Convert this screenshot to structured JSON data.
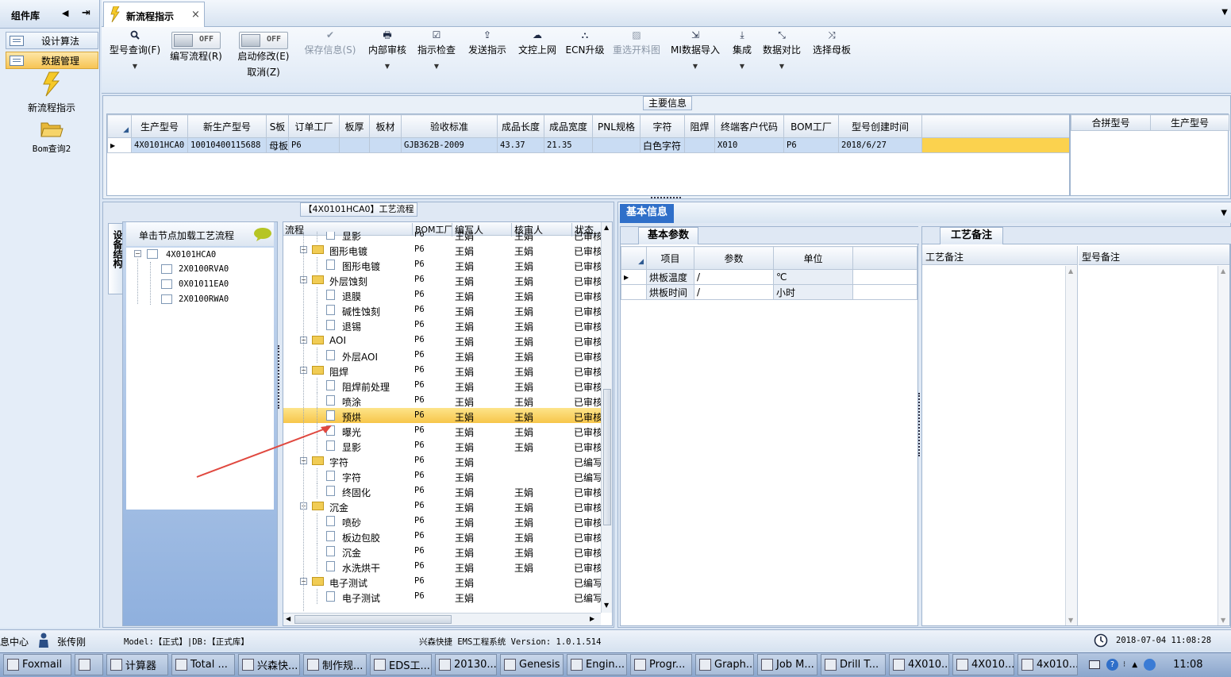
{
  "sidebar": {
    "title": "组件库",
    "items": [
      {
        "label": "设计算法"
      },
      {
        "label": "数据管理"
      }
    ],
    "launch": [
      {
        "label": "新流程指示"
      },
      {
        "label": "Bom查询2"
      }
    ]
  },
  "tabs": [
    {
      "label": "新流程指示",
      "close": "×"
    }
  ],
  "toolbar": {
    "query": {
      "label": "型号查询(F)"
    },
    "edit_flow": {
      "label": "编写流程(R)",
      "state": "OFF"
    },
    "start_edit": {
      "label": "启动修改(E)",
      "state": "OFF",
      "cancel": "取消(Z)"
    },
    "save": {
      "label": "保存信息(S)"
    },
    "review": {
      "label": "内部审核"
    },
    "check": {
      "label": "指示检查"
    },
    "send": {
      "label": "发送指示"
    },
    "doc_online": {
      "label": "文控上网"
    },
    "ecn": {
      "label": "ECN升级"
    },
    "reselect": {
      "label": "重选开料图"
    },
    "mi_import": {
      "label": "MI数据导入"
    },
    "integrate": {
      "label": "集成"
    },
    "compare": {
      "label": "数据对比"
    },
    "mother": {
      "label": "选择母板"
    }
  },
  "main_info": {
    "title": "主要信息",
    "columns": [
      "生产型号",
      "新生产型号",
      "S板",
      "订单工厂",
      "板厚",
      "板材",
      "验收标准",
      "成品长度",
      "成品宽度",
      "PNL规格",
      "字符",
      "阻焊",
      "终端客户代码",
      "BOM工厂",
      "型号创建时间"
    ],
    "row": [
      "4X0101HCA0",
      "10010400115688",
      "母板",
      "P6",
      "",
      "",
      "GJB362B-2009",
      "43.37",
      "21.35",
      "",
      "白色字符",
      "",
      "X010",
      "P6",
      "2018/6/27"
    ],
    "side_columns": [
      "合拼型号",
      "生产型号"
    ]
  },
  "flow": {
    "title": "【4X0101HCA0】工艺流程",
    "panel_tab": "设备结构",
    "load_hint": "单击节点加载工艺流程",
    "tree": [
      {
        "label": "4X0101HCA0"
      },
      {
        "label": "2X0100RVA0"
      },
      {
        "label": "0X01011EA0"
      },
      {
        "label": "2X0100RWA0"
      }
    ],
    "columns": [
      "流程",
      "BOM工厂",
      "编写人",
      "核审人",
      "状态"
    ],
    "rows": [
      {
        "name": "显影",
        "lvl": 2,
        "bom": "P6",
        "writer": "王娟",
        "rev": "王娟",
        "status": "已审核"
      },
      {
        "name": "图形电镀",
        "lvl": 1,
        "bom": "P6",
        "writer": "王娟",
        "rev": "王娟",
        "status": "已审核"
      },
      {
        "name": "图形电镀",
        "lvl": 2,
        "bom": "P6",
        "writer": "王娟",
        "rev": "王娟",
        "status": "已审核"
      },
      {
        "name": "外层蚀刻",
        "lvl": 1,
        "bom": "P6",
        "writer": "王娟",
        "rev": "王娟",
        "status": "已审核"
      },
      {
        "name": "退膜",
        "lvl": 2,
        "bom": "P6",
        "writer": "王娟",
        "rev": "王娟",
        "status": "已审核"
      },
      {
        "name": "碱性蚀刻",
        "lvl": 2,
        "bom": "P6",
        "writer": "王娟",
        "rev": "王娟",
        "status": "已审核"
      },
      {
        "name": "退锡",
        "lvl": 2,
        "bom": "P6",
        "writer": "王娟",
        "rev": "王娟",
        "status": "已审核"
      },
      {
        "name": "AOI",
        "lvl": 1,
        "bom": "P6",
        "writer": "王娟",
        "rev": "王娟",
        "status": "已审核"
      },
      {
        "name": "外层AOI",
        "lvl": 2,
        "bom": "P6",
        "writer": "王娟",
        "rev": "王娟",
        "status": "已审核"
      },
      {
        "name": "阻焊",
        "lvl": 1,
        "bom": "P6",
        "writer": "王娟",
        "rev": "王娟",
        "status": "已审核"
      },
      {
        "name": "阻焊前处理",
        "lvl": 2,
        "bom": "P6",
        "writer": "王娟",
        "rev": "王娟",
        "status": "已审核"
      },
      {
        "name": "喷涂",
        "lvl": 2,
        "bom": "P6",
        "writer": "王娟",
        "rev": "王娟",
        "status": "已审核"
      },
      {
        "name": "预烘",
        "lvl": 2,
        "bom": "P6",
        "writer": "王娟",
        "rev": "王娟",
        "status": "已审核"
      },
      {
        "name": "曝光",
        "lvl": 2,
        "bom": "P6",
        "writer": "王娟",
        "rev": "王娟",
        "status": "已审核"
      },
      {
        "name": "显影",
        "lvl": 2,
        "bom": "P6",
        "writer": "王娟",
        "rev": "王娟",
        "status": "已审核"
      },
      {
        "name": "字符",
        "lvl": 1,
        "bom": "P6",
        "writer": "王娟",
        "rev": "",
        "status": "已编写"
      },
      {
        "name": "字符",
        "lvl": 2,
        "bom": "P6",
        "writer": "王娟",
        "rev": "",
        "status": "已编写"
      },
      {
        "name": "终固化",
        "lvl": 2,
        "bom": "P6",
        "writer": "王娟",
        "rev": "王娟",
        "status": "已审核"
      },
      {
        "name": "沉金",
        "lvl": 1,
        "bom": "P6",
        "writer": "王娟",
        "rev": "王娟",
        "status": "已审核"
      },
      {
        "name": "喷砂",
        "lvl": 2,
        "bom": "P6",
        "writer": "王娟",
        "rev": "王娟",
        "status": "已审核"
      },
      {
        "name": "板边包胶",
        "lvl": 2,
        "bom": "P6",
        "writer": "王娟",
        "rev": "王娟",
        "status": "已审核"
      },
      {
        "name": "沉金",
        "lvl": 2,
        "bom": "P6",
        "writer": "王娟",
        "rev": "王娟",
        "status": "已审核"
      },
      {
        "name": "水洗烘干",
        "lvl": 2,
        "bom": "P6",
        "writer": "王娟",
        "rev": "王娟",
        "status": "已审核"
      },
      {
        "name": "电子测试",
        "lvl": 1,
        "bom": "P6",
        "writer": "王娟",
        "rev": "",
        "status": "已编写"
      },
      {
        "name": "电子测试",
        "lvl": 2,
        "bom": "P6",
        "writer": "王娟",
        "rev": "",
        "status": "已编写"
      }
    ]
  },
  "basic": {
    "title": "基本信息",
    "tab": "基本参数",
    "columns": [
      "项目",
      "参数",
      "单位"
    ],
    "rows": [
      {
        "item": "烘板温度",
        "param": "/",
        "unit": "℃"
      },
      {
        "item": "烘板时间",
        "param": "/",
        "unit": "小时"
      }
    ]
  },
  "notes": {
    "tab": "工艺备注",
    "col1": "工艺备注",
    "col2": "型号备注"
  },
  "status": {
    "center": "息中心",
    "user": "张传刚",
    "model": "Model:【正式】|DB:【正式库】",
    "app": "兴森快捷 EMS工程系统 Version: 1.0.1.514",
    "datetime": "2018-07-04 11:08:28"
  },
  "taskbar": {
    "items": [
      "Foxmail",
      "",
      "计算器",
      "Total ...",
      "兴森快...",
      "制作规...",
      "EDS工...",
      "20130...",
      "Genesis",
      "Engin...",
      "Progr...",
      "Graph...",
      "Job M...",
      "Drill T...",
      "4X010...",
      "4X010...",
      "4x010..."
    ],
    "time": "11:08"
  },
  "colors": {
    "selected_row": "#fbd24e",
    "header_blue": "#2f6fc9"
  }
}
